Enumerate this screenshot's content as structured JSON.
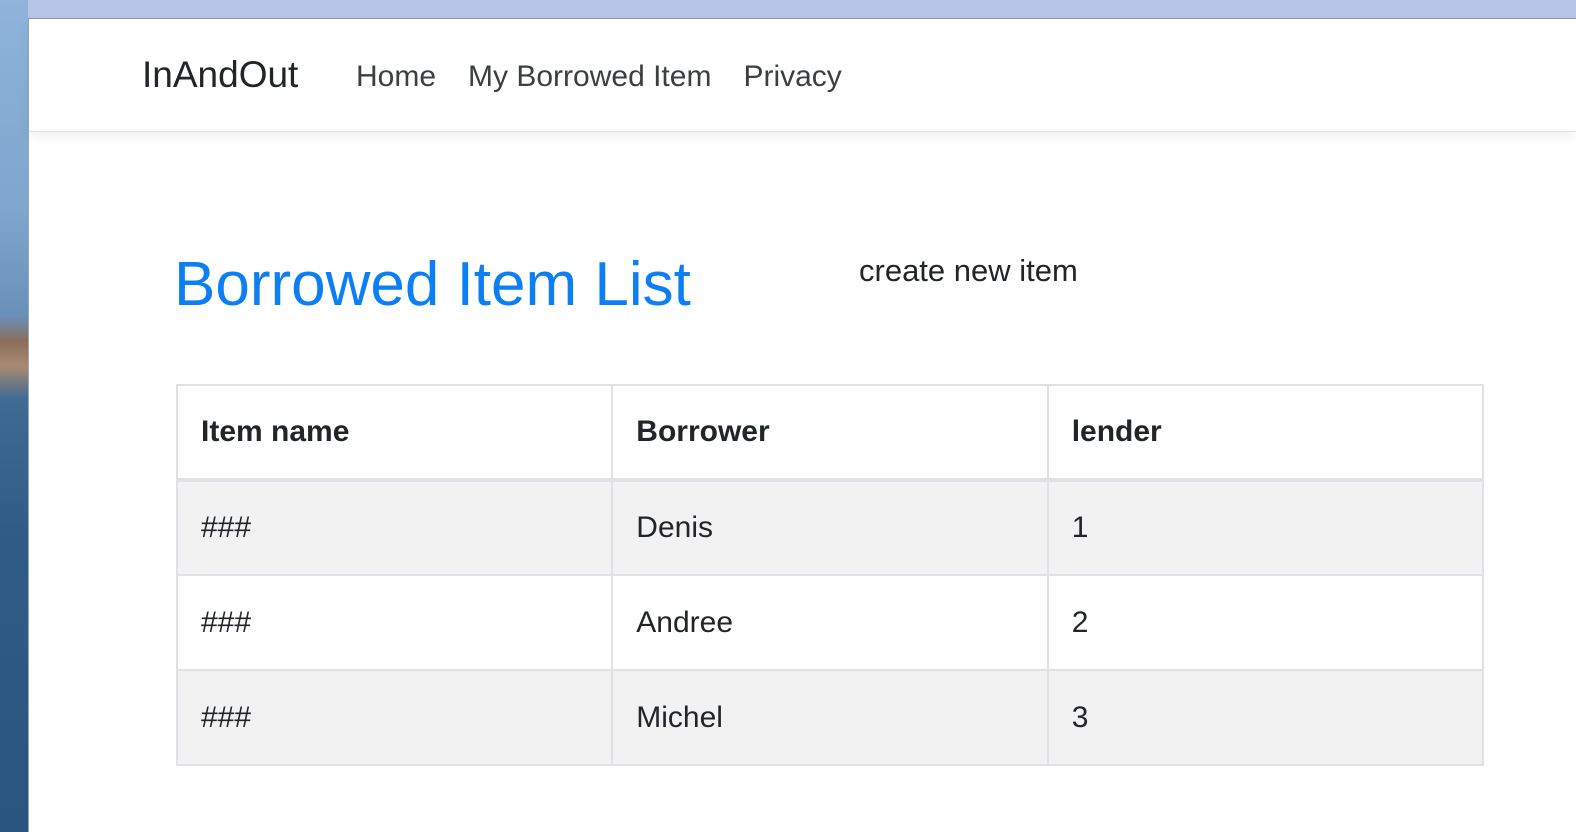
{
  "navbar": {
    "brand": "InAndOut",
    "links": [
      "Home",
      "My Borrowed Item",
      "Privacy"
    ]
  },
  "main": {
    "title": "Borrowed Item List",
    "create_link": "create new item"
  },
  "table": {
    "headers": [
      "Item name",
      "Borrower",
      "lender"
    ],
    "rows": [
      [
        "###",
        "Denis",
        "1"
      ],
      [
        "###",
        "Andree",
        "2"
      ],
      [
        "###",
        "Michel",
        "3"
      ]
    ]
  },
  "colors": {
    "title": "#0d7ff5",
    "striped_row": "#f2f2f2",
    "border": "#dee2e6"
  }
}
